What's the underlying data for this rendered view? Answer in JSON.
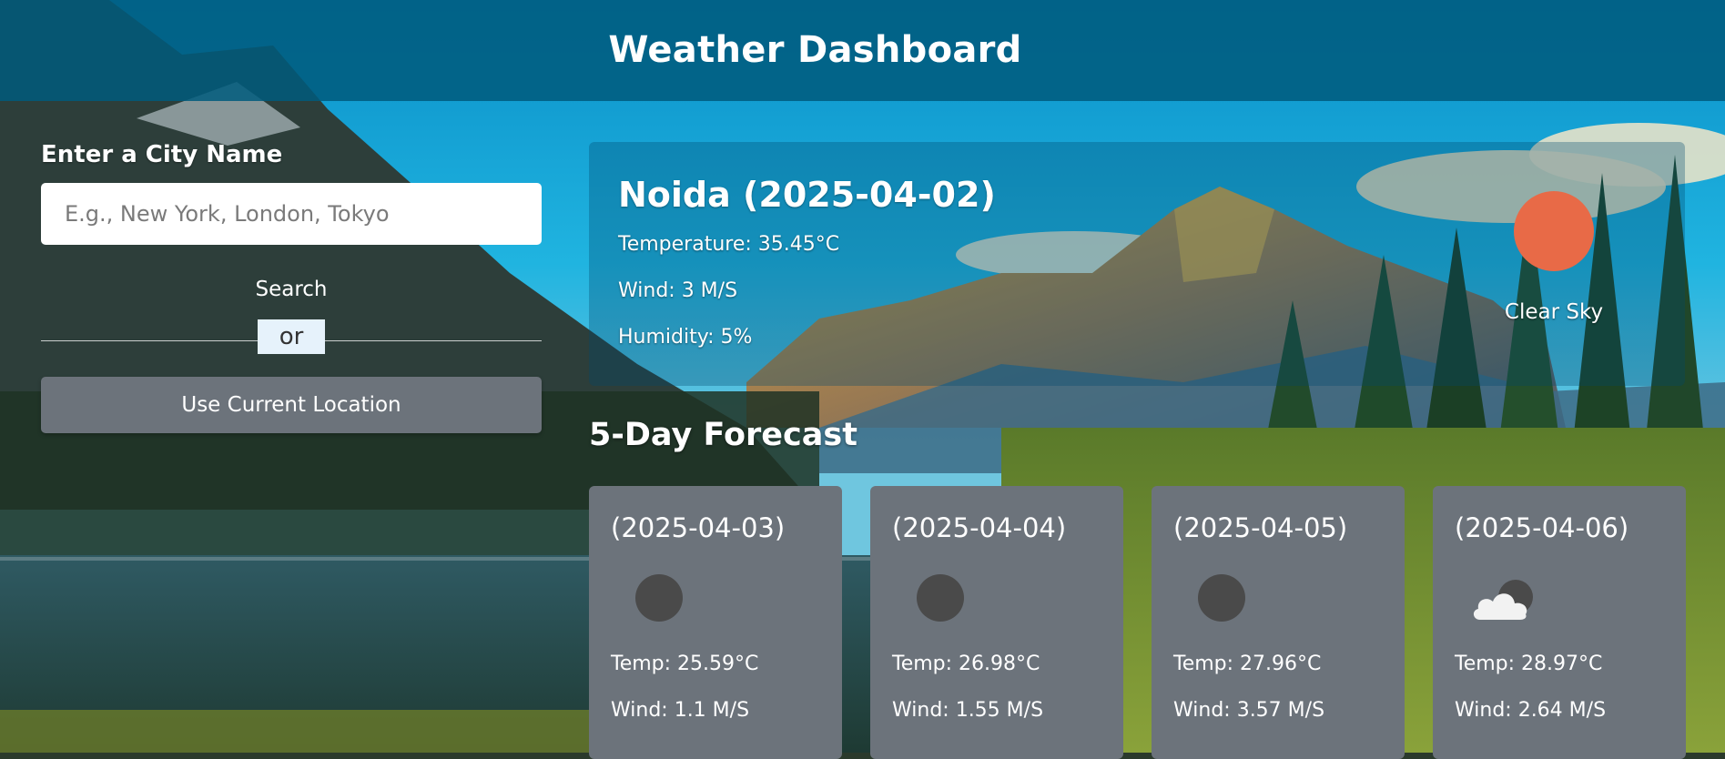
{
  "header": {
    "title": "Weather Dashboard"
  },
  "search": {
    "label": "Enter a City Name",
    "placeholder": "E.g., New York, London, Tokyo",
    "value": "",
    "search_label": "Search",
    "divider_label": "or",
    "location_label": "Use Current Location"
  },
  "current": {
    "title": "Noida (2025-04-02)",
    "temperature": "Temperature: 35.45°C",
    "wind": "Wind: 3 M/S",
    "humidity": "Humidity: 5%",
    "condition": "Clear Sky",
    "icon": "clear-sky-sun-icon",
    "icon_color": "#e86a47"
  },
  "forecast": {
    "title": "5-Day Forecast",
    "days": [
      {
        "date": "(2025-04-03)",
        "icon": "moon-icon",
        "temp": "Temp: 25.59°C",
        "wind": "Wind: 1.1 M/S"
      },
      {
        "date": "(2025-04-04)",
        "icon": "moon-icon",
        "temp": "Temp: 26.98°C",
        "wind": "Wind: 1.55 M/S"
      },
      {
        "date": "(2025-04-05)",
        "icon": "moon-icon",
        "temp": "Temp: 27.96°C",
        "wind": "Wind: 3.57 M/S"
      },
      {
        "date": "(2025-04-06)",
        "icon": "partly-cloudy-night-icon",
        "temp": "Temp: 28.97°C",
        "wind": "Wind: 2.64 M/S"
      }
    ]
  },
  "colors": {
    "header_bg": "#005a7d",
    "card_bg": "#6c737b",
    "button_bg": "#6c737b",
    "accent_sun": "#e86a47"
  }
}
